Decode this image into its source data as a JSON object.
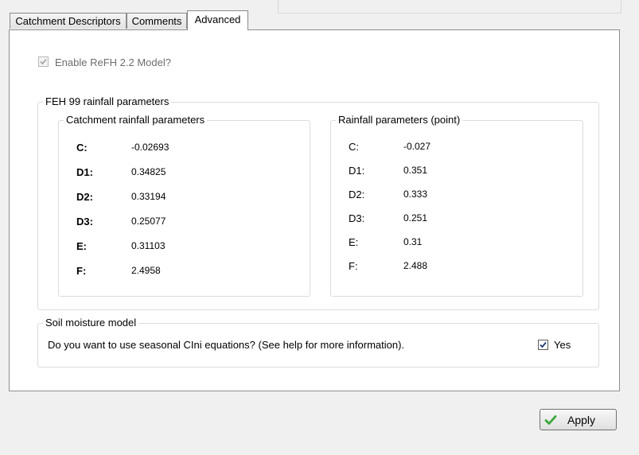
{
  "tabs": [
    {
      "label": "Catchment Descriptors"
    },
    {
      "label": "Comments"
    },
    {
      "label": "Advanced",
      "active": true
    }
  ],
  "enable_model": {
    "label": "Enable ReFH 2.2 Model?",
    "checked": true,
    "disabled": true
  },
  "feh99": {
    "title": "FEH 99 rainfall parameters",
    "catchment": {
      "title": "Catchment rainfall parameters",
      "rows": [
        {
          "label": "C:",
          "value": "-0.02693"
        },
        {
          "label": "D1:",
          "value": "0.34825"
        },
        {
          "label": "D2:",
          "value": "0.33194"
        },
        {
          "label": "D3:",
          "value": "0.25077"
        },
        {
          "label": "E:",
          "value": "0.31103"
        },
        {
          "label": "F:",
          "value": "2.4958"
        }
      ]
    },
    "point": {
      "title": "Rainfall parameters (point)",
      "rows": [
        {
          "label": "C:",
          "value": "-0.027"
        },
        {
          "label": "D1:",
          "value": "0.351"
        },
        {
          "label": "D2:",
          "value": "0.333"
        },
        {
          "label": "D3:",
          "value": "0.251"
        },
        {
          "label": "E:",
          "value": "0.31"
        },
        {
          "label": "F:",
          "value": "2.488"
        }
      ]
    }
  },
  "soil": {
    "title": "Soil moisture model",
    "question": "Do you want to use seasonal CIni equations? (See help for more information).",
    "yes_label": "Yes",
    "yes_checked": true
  },
  "apply": {
    "label": "Apply",
    "icon": "green-check-icon"
  },
  "colors": {
    "check_green": "#3aa63a",
    "panel_border": "#8e8e8e",
    "group_border": "#dcdcdc"
  }
}
